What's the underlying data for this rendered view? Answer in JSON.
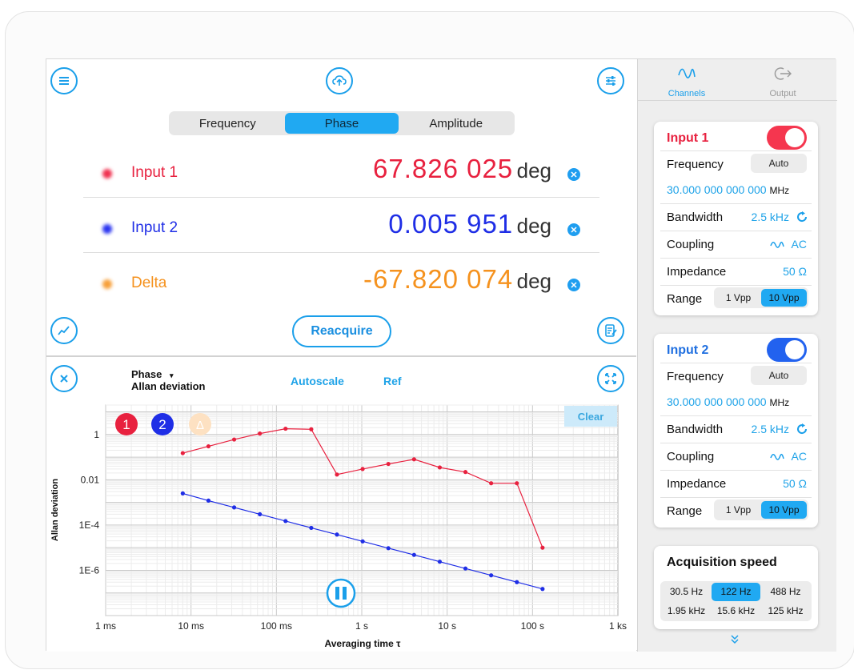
{
  "toolbar": {
    "menu_icon": "hamburger-menu-icon",
    "cloud_icon": "cloud-upload-icon",
    "settings_icon": "sliders-icon"
  },
  "tabs": [
    {
      "label": "Frequency",
      "active": false
    },
    {
      "label": "Phase",
      "active": true
    },
    {
      "label": "Amplitude",
      "active": false
    }
  ],
  "measurements": [
    {
      "name": "Input 1",
      "value": "67.826 025",
      "unit": "deg",
      "color": "#e8213f"
    },
    {
      "name": "Input 2",
      "value": "0.005 951",
      "unit": "deg",
      "color": "#1f2ee6"
    },
    {
      "name": "Delta",
      "value": "-67.820 074",
      "unit": "deg",
      "color": "#f5921e"
    }
  ],
  "reacquire_label": "Reacquire",
  "plot": {
    "mode_label": "Phase",
    "mode_arrow": "▾",
    "stat_label": "Allan deviation",
    "autoscale_label": "Autoscale",
    "ref_label": "Ref",
    "clear_label": "Clear",
    "badges": [
      "1",
      "2",
      "Δ"
    ]
  },
  "chart_data": {
    "type": "line",
    "xlabel": "Averaging time τ",
    "ylabel": "Allan deviation",
    "x_scale": "log",
    "y_scale": "log",
    "xlim": [
      0.001,
      1000
    ],
    "ylim": [
      1e-08,
      20
    ],
    "x_ticks": [
      "1 ms",
      "10 ms",
      "100 ms",
      "1 s",
      "10 s",
      "100 s",
      "1 ks"
    ],
    "y_ticks": [
      "1",
      "0.01",
      "1E-4",
      "1E-6"
    ],
    "grid": true,
    "series": [
      {
        "color": "#e8213f",
        "x": [
          0.008,
          0.016,
          0.032,
          0.064,
          0.128,
          0.256,
          0.512,
          1.024,
          2.048,
          4.096,
          8.192,
          16.384,
          32.768,
          65.536,
          131.072
        ],
        "y": [
          0.15,
          0.3,
          0.6,
          1.1,
          1.8,
          1.7,
          0.017,
          0.03,
          0.05,
          0.08,
          0.035,
          0.022,
          0.007,
          0.007,
          1e-05
        ]
      },
      {
        "color": "#1f2ee6",
        "x": [
          0.008,
          0.016,
          0.032,
          0.064,
          0.128,
          0.256,
          0.512,
          1.024,
          2.048,
          4.096,
          8.192,
          16.384,
          32.768,
          65.536,
          131.072
        ],
        "y": [
          0.0025,
          0.0012,
          0.0006,
          0.0003,
          0.00015,
          7.5e-05,
          3.8e-05,
          1.9e-05,
          9.5e-06,
          4.8e-06,
          2.4e-06,
          1.2e-06,
          6e-07,
          3e-07,
          1.5e-07
        ]
      }
    ]
  },
  "sidebar": {
    "tabs": [
      {
        "label": "Channels",
        "active": true,
        "icon": "sine-wave-icon"
      },
      {
        "label": "Output",
        "active": false,
        "icon": "exit-arrow-icon"
      }
    ],
    "inputs": [
      {
        "title": "Input 1",
        "title_color": "#e8213f",
        "toggle_color": "#f5364f",
        "frequency_label": "Frequency",
        "auto_label": "Auto",
        "frequency_value": "30.000 000 000 000",
        "frequency_unit": "MHz",
        "bandwidth_label": "Bandwidth",
        "bandwidth_value": "2.5 kHz",
        "coupling_label": "Coupling",
        "coupling_value": "AC",
        "impedance_label": "Impedance",
        "impedance_value": "50 Ω",
        "range_label": "Range",
        "range_options": [
          "1 Vpp",
          "10 Vpp"
        ],
        "range_selected": 1
      },
      {
        "title": "Input 2",
        "title_color": "#1f6fe0",
        "toggle_color": "#2262ef",
        "frequency_label": "Frequency",
        "auto_label": "Auto",
        "frequency_value": "30.000 000 000 000",
        "frequency_unit": "MHz",
        "bandwidth_label": "Bandwidth",
        "bandwidth_value": "2.5 kHz",
        "coupling_label": "Coupling",
        "coupling_value": "AC",
        "impedance_label": "Impedance",
        "impedance_value": "50 Ω",
        "range_label": "Range",
        "range_options": [
          "1 Vpp",
          "10 Vpp"
        ],
        "range_selected": 1
      }
    ],
    "acquisition": {
      "title": "Acquisition speed",
      "options": [
        "30.5 Hz",
        "122 Hz",
        "488 Hz",
        "1.95 kHz",
        "15.6 kHz",
        "125 kHz"
      ],
      "selected": 1
    },
    "more_icon": "double-chevron-down-icon"
  }
}
